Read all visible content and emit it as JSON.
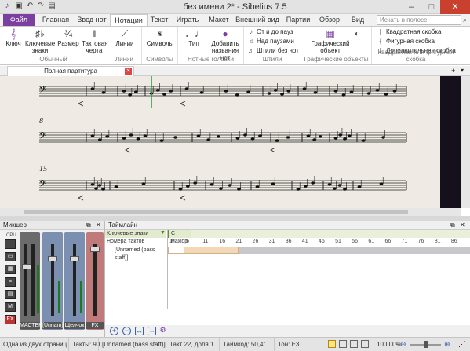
{
  "titlebar": {
    "title": "без имени 2* - Sibelius 7.5"
  },
  "tabs": [
    {
      "label": "Файл"
    },
    {
      "label": "Главная"
    },
    {
      "label": "Ввод нот"
    },
    {
      "label": "Нотации"
    },
    {
      "label": "Текст"
    },
    {
      "label": "Играть"
    },
    {
      "label": "Макет"
    },
    {
      "label": "Внешний вид"
    },
    {
      "label": "Партии"
    },
    {
      "label": "Обзор"
    },
    {
      "label": "Вид"
    }
  ],
  "search": {
    "placeholder": "Искать в полосе"
  },
  "ribbon": {
    "group_normal": "Обычный",
    "clef": "Ключ",
    "key_sig": "Ключевые знаки",
    "time_sig": "Размер",
    "barline": "Тактовая черта",
    "group_lines": "Линии",
    "lines": "Линии",
    "group_symbols": "Символы",
    "symbols": "Символы",
    "group_noteheads": "Нотные головки",
    "type": "Тип",
    "add_note_names": "Добавить названия нот",
    "group_beams": "Штили",
    "to_rest": "От и до пауз",
    "over_rests": "Над паузами",
    "stemless": "Штили без нот",
    "group_graphics": "Графические объекты",
    "graphic": "Графический объект",
    "group_brackets": "Квадратная или фигурная скобка",
    "square_bracket": "Квадратная скобка",
    "curly_bracket": "Фигурная скобка",
    "extra_bracket": "Дополнительная скобка"
  },
  "doc_tab": {
    "label": "Полная партитура"
  },
  "score": {
    "systems": [
      {
        "number": ""
      },
      {
        "number": "8"
      },
      {
        "number": "15"
      }
    ]
  },
  "mixer": {
    "title": "Микшер",
    "cpu": "CPU",
    "strips": [
      {
        "label": "МАСТЕР",
        "color": "#6b6b6b"
      },
      {
        "label": "[Unnam]",
        "color": "#7b8fb0"
      },
      {
        "label": "Щелчок",
        "color": "#7b8fb0"
      },
      {
        "label": "FX",
        "color": "#c07a7a"
      }
    ]
  },
  "timeline": {
    "title": "Таймлайн",
    "key_sig_label": "Ключевые знаки",
    "key_value": "С мажор",
    "bar_numbers_label": "Номера тактов",
    "staff_label": "[Unnamed (bass staff)]",
    "ruler": [
      "1",
      "6",
      "11",
      "16",
      "21",
      "26",
      "31",
      "36",
      "41",
      "46",
      "51",
      "56",
      "61",
      "66",
      "71",
      "76",
      "81",
      "86"
    ]
  },
  "status": {
    "pages": "Одна из двух страниц",
    "bars": "Такты: 90",
    "staff": "[Unnamed (bass staff)]",
    "position": "Такт 22, доля 1",
    "timecode": "Таймкод: 50,4\"",
    "key": "Тон: E3",
    "zoom": "100,00%"
  }
}
